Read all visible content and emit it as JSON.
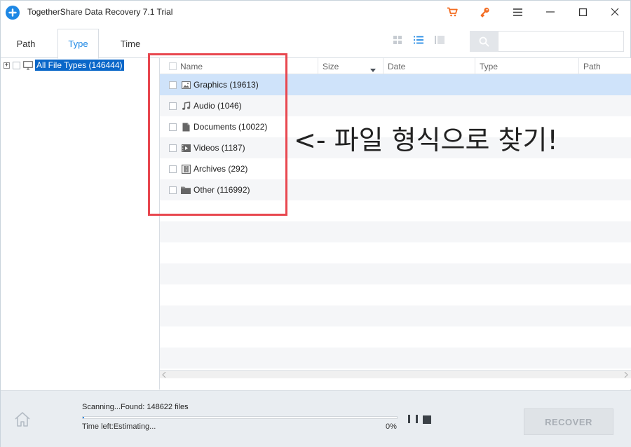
{
  "window": {
    "title": "TogetherShare Data Recovery 7.1 Trial",
    "icons": {
      "logo": "plus-circle-icon",
      "buy": "cart-icon",
      "register": "key-icon",
      "menu": "hamburger-icon",
      "minimize": "minimize-icon",
      "maximize": "maximize-icon",
      "close": "close-icon"
    },
    "accent_colors": {
      "cart": "#f36c21",
      "key": "#f36c21",
      "brand": "#1e88e5"
    }
  },
  "tabs": [
    {
      "label": "Path",
      "active": false
    },
    {
      "label": "Type",
      "active": true
    },
    {
      "label": "Time",
      "active": false
    }
  ],
  "view_modes": [
    "grid-view-icon",
    "list-view-icon",
    "detail-view-icon"
  ],
  "search": {
    "placeholder": "",
    "value": ""
  },
  "tree": {
    "expander": "+",
    "icon": "computer-icon",
    "root_label": "All File Types (146444)"
  },
  "table": {
    "columns": [
      "Name",
      "Size",
      "Date",
      "Type",
      "Path"
    ],
    "sort_column": "Size",
    "rows": [
      {
        "label": "Graphics (19613)",
        "icon": "image-icon",
        "selected": true
      },
      {
        "label": "Audio (1046)",
        "icon": "music-icon",
        "selected": false
      },
      {
        "label": "Documents (10022)",
        "icon": "document-icon",
        "selected": false
      },
      {
        "label": "Videos (1187)",
        "icon": "video-icon",
        "selected": false
      },
      {
        "label": "Archives (292)",
        "icon": "archive-icon",
        "selected": false
      },
      {
        "label": "Other (116992)",
        "icon": "folder-icon",
        "selected": false
      }
    ]
  },
  "annotation": {
    "text": "<- 파일 형식으로 찾기!",
    "highlight_color": "#e8474f"
  },
  "status": {
    "scan_text": "Scanning...Found: 148622 files",
    "time_left": "Time left:Estimating...",
    "percent": "0%",
    "progress_fraction": 0.005
  },
  "bottom": {
    "home_icon": "home-icon",
    "pause_icon": "pause-icon",
    "stop_icon": "stop-icon",
    "recover_label": "RECOVER"
  }
}
